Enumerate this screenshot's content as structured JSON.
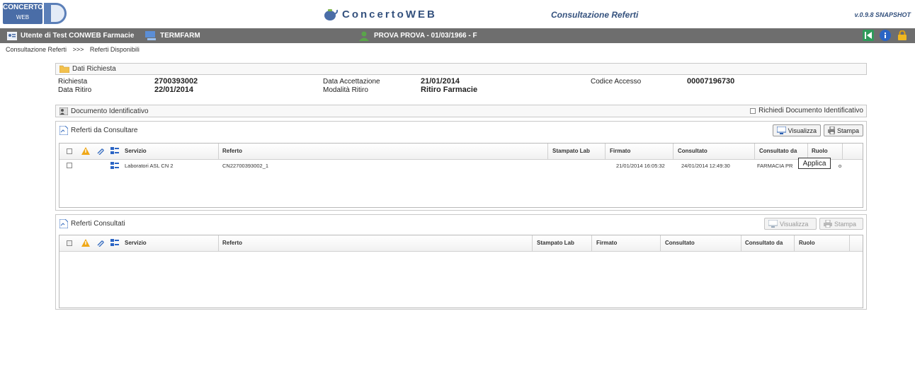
{
  "app": {
    "logo_text": "CONCERTO",
    "logo_sub": "WEB",
    "brand": "ConcertoWEB",
    "page_title": "Consultazione Referti",
    "version": "v.0.9.8 SNAPSHOT"
  },
  "userbar": {
    "user": "Utente di Test CONWEB Farmacie",
    "terminal": "TERMFARM",
    "patient": "PROVA PROVA - 01/03/1966 - F"
  },
  "breadcrumb": {
    "item1": "Consultazione Referti",
    "sep": ">>>",
    "item2": "Referti Disponibili"
  },
  "richiesta": {
    "title": "Dati Richiesta",
    "richiesta_label": "Richiesta",
    "richiesta_value": "2700393002",
    "ritiro_label": "Data Ritiro",
    "ritiro_value": "22/01/2014",
    "accettazione_label": "Data Accettazione",
    "accettazione_value": "21/01/2014",
    "modalita_label": "Modalità Ritiro",
    "modalita_value": "Ritiro Farmacie",
    "codice_label": "Codice Accesso",
    "codice_value": "00007196730"
  },
  "documento": {
    "title": "Documento Identificativo",
    "richiedi_label": "Richiedi Documento Identificativo"
  },
  "da_consultare": {
    "title": "Referti da Consultare",
    "visualizza": "Visualizza",
    "stampa": "Stampa",
    "columns": {
      "servizio": "Servizio",
      "referto": "Referto",
      "stampato": "Stampato Lab",
      "firmato": "Firmato",
      "consultato": "Consultato",
      "consultato_da": "Consultato da",
      "ruolo": "Ruolo"
    },
    "row": {
      "servizio": "Laboratori ASL CN 2",
      "referto": "CN22700393002_1",
      "firmato": "21/01/2014 16:05:32",
      "consultato": "24/01/2014 12:49:30",
      "consultato_da": "FARMACIA PR",
      "ruolo": "o"
    },
    "tooltip": "Applica"
  },
  "consultati": {
    "title": "Referti Consultati",
    "visualizza": "Visualizza",
    "stampa": "Stampa",
    "columns": {
      "servizio": "Servizio",
      "referto": "Referto",
      "stampato": "Stampato Lab",
      "firmato": "Firmato",
      "consultato": "Consultato",
      "consultato_da": "Consultato da",
      "ruolo": "Ruolo"
    }
  }
}
